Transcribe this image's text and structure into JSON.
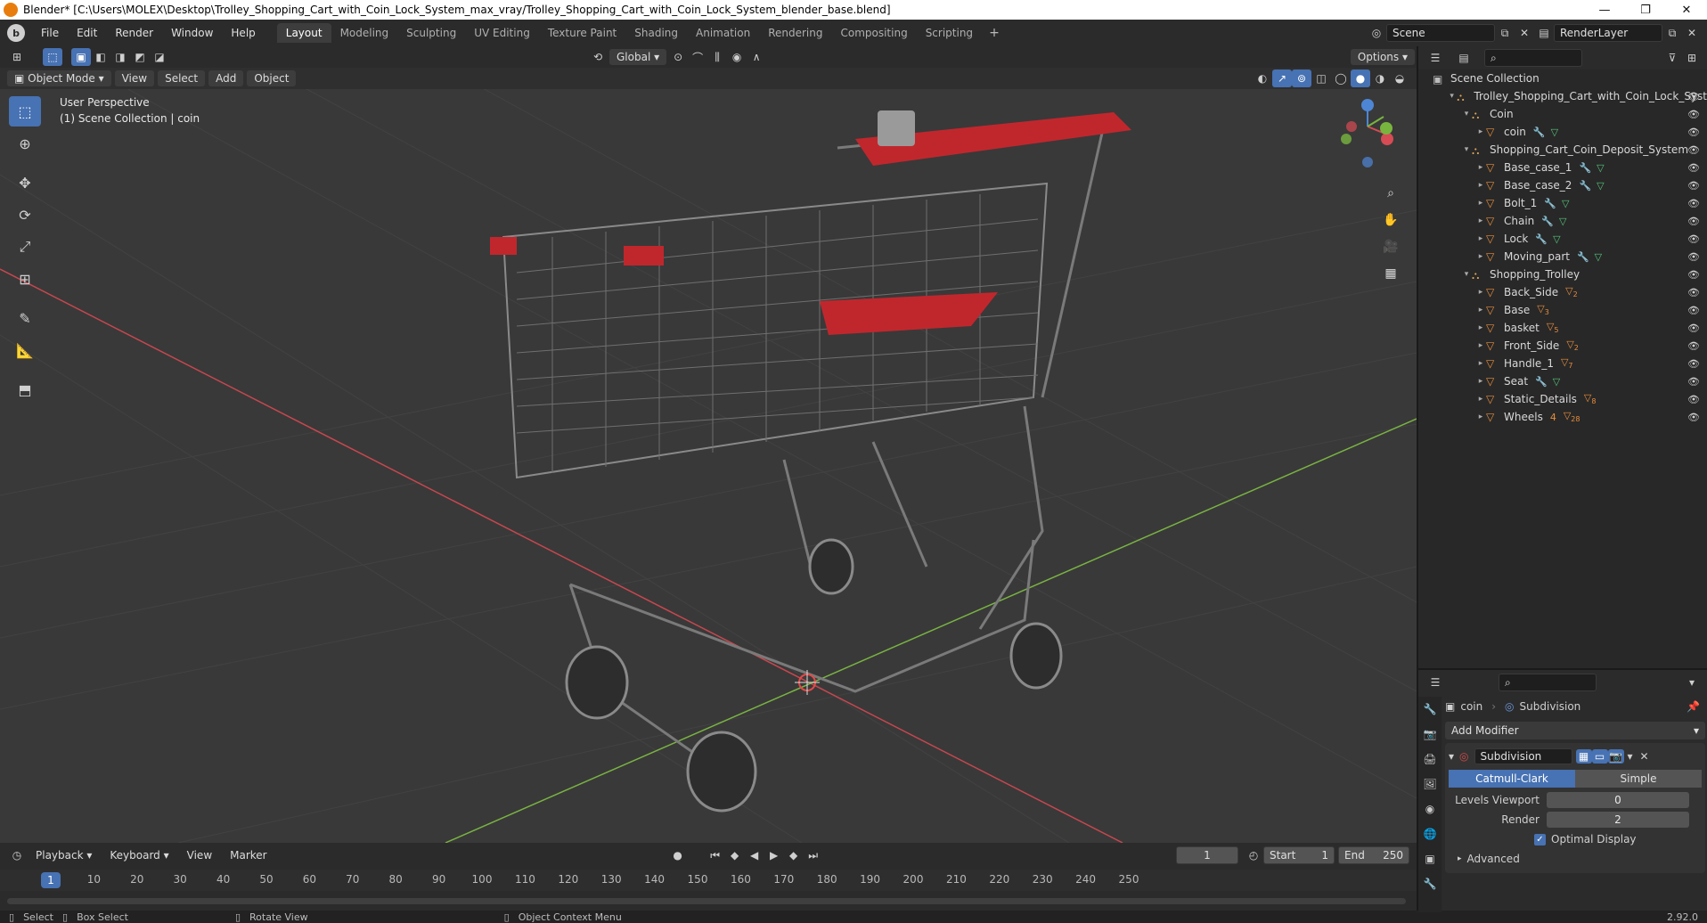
{
  "window": {
    "title": "Blender* [C:\\Users\\MOLEX\\Desktop\\Trolley_Shopping_Cart_with_Coin_Lock_System_max_vray/Trolley_Shopping_Cart_with_Coin_Lock_System_blender_base.blend]"
  },
  "menu": [
    "File",
    "Edit",
    "Render",
    "Window",
    "Help"
  ],
  "workspaces": [
    "Layout",
    "Modeling",
    "Sculpting",
    "UV Editing",
    "Texture Paint",
    "Shading",
    "Animation",
    "Rendering",
    "Compositing",
    "Scripting"
  ],
  "scene": {
    "name": "Scene",
    "render_layer": "RenderLayer"
  },
  "tool_header": {
    "orientation": "Global",
    "options": "Options"
  },
  "viewport_header": {
    "mode": "Object Mode",
    "menus": [
      "View",
      "Select",
      "Add",
      "Object"
    ]
  },
  "viewport": {
    "perspective": "User Perspective",
    "context": "(1) Scene Collection | coin"
  },
  "gizmo": {
    "x": "X",
    "y": "Y",
    "z": "Z"
  },
  "timeline": {
    "menus": [
      "Playback",
      "Keyboard",
      "View",
      "Marker"
    ],
    "current_frame": "1",
    "start_label": "Start",
    "start": "1",
    "end_label": "End",
    "end": "250",
    "ticks": [
      "1",
      "10",
      "20",
      "30",
      "40",
      "50",
      "60",
      "70",
      "80",
      "90",
      "100",
      "110",
      "120",
      "130",
      "140",
      "150",
      "160",
      "170",
      "180",
      "190",
      "200",
      "210",
      "220",
      "230",
      "240",
      "250"
    ]
  },
  "statusbar": {
    "select": "Select",
    "box_select": "Box Select",
    "rotate": "Rotate View",
    "context_menu": "Object Context Menu",
    "version": "2.92.0"
  },
  "outliner": {
    "root": "Scene Collection",
    "rows": [
      {
        "label": "Trolley_Shopping_Cart_with_Coin_Lock_Syst",
        "kind": "collection",
        "depth": 1
      },
      {
        "label": "Coin",
        "kind": "collection",
        "depth": 2
      },
      {
        "label": "coin",
        "kind": "object",
        "depth": 3,
        "mods": true
      },
      {
        "label": "Shopping_Cart_Coin_Deposit_System",
        "kind": "collection",
        "depth": 2
      },
      {
        "label": "Base_case_1",
        "kind": "object",
        "depth": 3,
        "mods": true
      },
      {
        "label": "Base_case_2",
        "kind": "object",
        "depth": 3,
        "mods": true
      },
      {
        "label": "Bolt_1",
        "kind": "object",
        "depth": 3,
        "mods": true
      },
      {
        "label": "Chain",
        "kind": "object",
        "depth": 3,
        "mods": true
      },
      {
        "label": "Lock",
        "kind": "object",
        "depth": 3,
        "mods": true
      },
      {
        "label": "Moving_part",
        "kind": "object",
        "depth": 3,
        "mods": true
      },
      {
        "label": "Shopping_Trolley",
        "kind": "collection",
        "depth": 2
      },
      {
        "label": "Back_Side",
        "kind": "object",
        "depth": 3,
        "count": "2"
      },
      {
        "label": "Base",
        "kind": "object",
        "depth": 3,
        "count": "3"
      },
      {
        "label": "basket",
        "kind": "object",
        "depth": 3,
        "count": "5"
      },
      {
        "label": "Front_Side",
        "kind": "object",
        "depth": 3,
        "count": "2"
      },
      {
        "label": "Handle_1",
        "kind": "object",
        "depth": 3,
        "count": "7"
      },
      {
        "label": "Seat",
        "kind": "object",
        "depth": 3,
        "mods": true
      },
      {
        "label": "Static_Details",
        "kind": "object",
        "depth": 3,
        "count": "8"
      },
      {
        "label": "Wheels",
        "kind": "object",
        "depth": 3,
        "count": "28",
        "sub": "4"
      }
    ]
  },
  "properties": {
    "object": "coin",
    "modifier_tab": "Subdivision",
    "add_modifier": "Add Modifier",
    "modifier_name": "Subdivision",
    "algorithms": [
      "Catmull-Clark",
      "Simple"
    ],
    "levels_viewport_label": "Levels Viewport",
    "levels_viewport": "0",
    "render_label": "Render",
    "render": "2",
    "optimal_display": "Optimal Display",
    "advanced": "Advanced"
  },
  "colors": {
    "accent": "#4772b3",
    "viewport_bg": "#393939",
    "x_axis": "#c8474f",
    "y_axis": "#7ab342",
    "trolley_red": "#c0272d"
  }
}
